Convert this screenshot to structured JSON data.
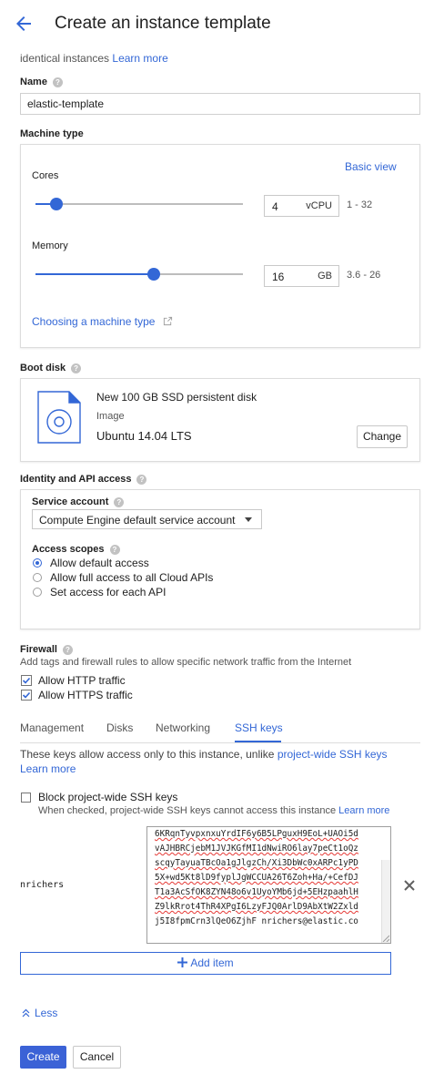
{
  "header": {
    "title": "Create an instance template"
  },
  "intro": {
    "text": "identical instances",
    "learn_more": "Learn more"
  },
  "name": {
    "label": "Name",
    "value": "elastic-template"
  },
  "machine_type": {
    "label": "Machine type",
    "basic_view": "Basic view",
    "cores": {
      "label": "Cores",
      "value": "4",
      "unit": "vCPU",
      "range": "1 - 32",
      "slider_fraction": 0.1
    },
    "memory": {
      "label": "Memory",
      "value": "16",
      "unit": "GB",
      "range": "3.6 - 26",
      "slider_fraction": 0.57
    },
    "choosing_link": "Choosing a machine type"
  },
  "boot_disk": {
    "label": "Boot disk",
    "title": "New 100 GB SSD persistent disk",
    "image_label": "Image",
    "image_value": "Ubuntu 14.04 LTS",
    "change_button": "Change"
  },
  "identity": {
    "label": "Identity and API access",
    "service_account_label": "Service account",
    "service_account_value": "Compute Engine default service account",
    "access_scopes_label": "Access scopes",
    "scopes": [
      {
        "label": "Allow default access",
        "selected": true
      },
      {
        "label": "Allow full access to all Cloud APIs",
        "selected": false
      },
      {
        "label": "Set access for each API",
        "selected": false
      }
    ]
  },
  "firewall": {
    "label": "Firewall",
    "description": "Add tags and firewall rules to allow specific network traffic from the Internet",
    "http": "Allow HTTP traffic",
    "https": "Allow HTTPS traffic"
  },
  "tabs": [
    "Management",
    "Disks",
    "Networking",
    "SSH keys"
  ],
  "active_tab": "SSH keys",
  "ssh": {
    "info": "These keys allow access only to this instance, unlike",
    "project_link": "project-wide SSH keys",
    "learn_more": "Learn more",
    "block_label": "Block project-wide SSH keys",
    "block_hint": "When checked, project-wide SSH keys cannot access this instance",
    "block_learn_more": "Learn more",
    "username": "nrichers",
    "key_lines": [
      "6KRqnTyvpxnxuYrdIF6y6B5LPguxH9EoL+UAOi5d",
      "vAJHBRCjebM1JVJKGfMI1dNwiRO6lay7peCt1oQz",
      "scqyTayuaTBcOa1gJlgzCh/Xi3DbWc0xARPc1yPD",
      "5X+wd5Kt8lD9fyplJgWCCUA26T6Zoh+Ha/+CefDJ",
      "T1a3AcSfOK8ZYN48o6v1UyoYMb6jd+5EHzpaahlH",
      "Z9lkRrot4ThR4XPgI6LzyFJQ0ArlD9AbXtW2Zxld",
      "j5I8fpmCrn3lQeO6ZjhF nrichers@elastic.co"
    ],
    "add_item": "Add item"
  },
  "less_link": "Less",
  "actions": {
    "create": "Create",
    "cancel": "Cancel"
  },
  "colors": {
    "accent": "#3367d6",
    "create_bg": "#3b62d6"
  }
}
